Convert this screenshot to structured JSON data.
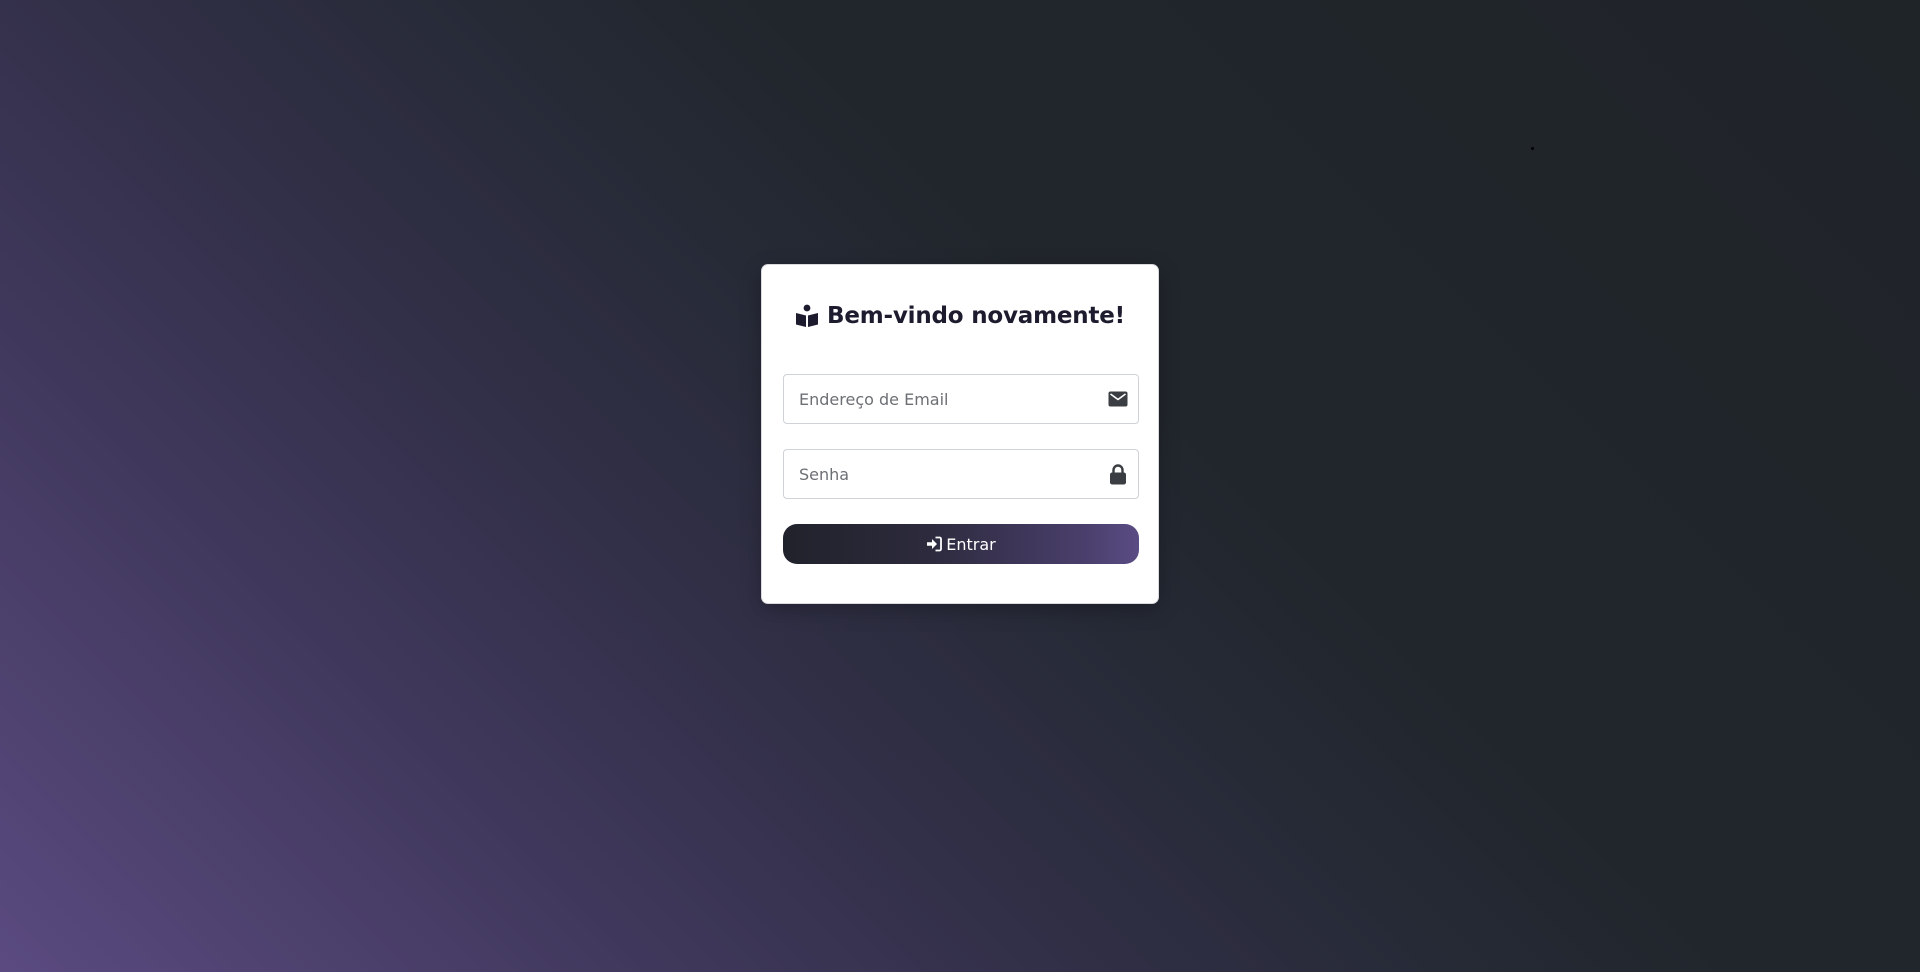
{
  "login": {
    "title": "Bem-vindo novamente!",
    "title_icon": "book-reader-icon",
    "email": {
      "placeholder": "Endereço de Email",
      "value": "",
      "icon": "envelope-icon"
    },
    "password": {
      "placeholder": "Senha",
      "value": "",
      "icon": "lock-icon"
    },
    "submit": {
      "label": "Entrar",
      "icon": "sign-in-icon"
    }
  },
  "colors": {
    "background_gradient_start": "#5a4a80",
    "background_gradient_end": "#1f2429",
    "card_background": "#ffffff",
    "title_color": "#1d1b2e",
    "button_gradient_start": "#20222b",
    "button_gradient_end": "#5a4c84"
  }
}
